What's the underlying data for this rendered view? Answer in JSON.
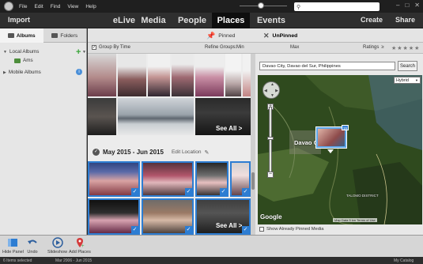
{
  "menubar": {
    "items": [
      "File",
      "Edit",
      "Find",
      "View",
      "Help"
    ],
    "search_placeholder": "",
    "window_buttons": [
      "–",
      "□",
      "✕"
    ]
  },
  "nav": {
    "import_label": "Import",
    "tabs": [
      "eLive",
      "Media",
      "People",
      "Places",
      "Events"
    ],
    "active_tab": "Places",
    "create_label": "Create",
    "share_label": "Share"
  },
  "sidebar": {
    "tabs": [
      "Albums",
      "Folders"
    ],
    "local_albums_label": "Local Albums",
    "album_name": "Ams",
    "mobile_albums_label": "Mobile Albums",
    "add_symbol": "+",
    "info_symbol": "i"
  },
  "places": {
    "pinned_label": "Pinned",
    "unpinned_label": "UnPinned",
    "group_by_time_label": "Group By Time",
    "refine_groups_label": "Refine Groups:",
    "min_label": "Min",
    "max_label": "Max",
    "ratings_label": "Ratings",
    "ratings_op": "≥",
    "stars": "★★★★★"
  },
  "grid": {
    "group_title": "May 2015 - Jun 2015",
    "edit_location_label": "Edit Location",
    "see_all_label": "See All >"
  },
  "map": {
    "location_value": "Davao City, Davao del Sur, Philippines",
    "search_label": "Search",
    "map_type": "Hybrid",
    "city_label": "Davao C",
    "district_label": "TALOMO DISTRICT",
    "pin_count": "15",
    "google_label": "Google",
    "footer_text": "Map Data  5 km  Terms of Use",
    "show_pinned_label": "Show Already Pinned Media"
  },
  "toolbar": {
    "hide_panel_label": "Hide Panel",
    "undo_label": "Undo",
    "slideshow_label": "Slideshow",
    "add_places_label": "Add Places"
  },
  "status": {
    "selected": "6 Items selected",
    "date_range": "Mar 2006 - Jun 2015",
    "catalog": "My Catalog"
  },
  "colors": {
    "accent_blue": "#2d7dd2",
    "active_tab_bg": "#0e0e0e",
    "add_green": "#3aa53a"
  }
}
